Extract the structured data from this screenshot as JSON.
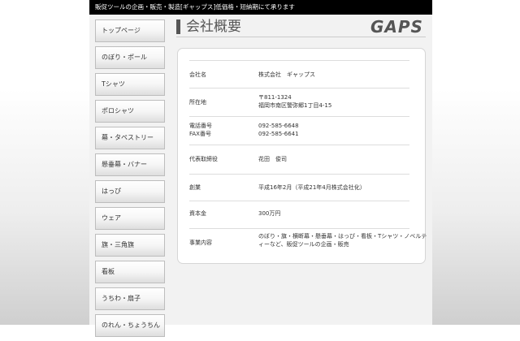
{
  "header": {
    "tagline": "販促ツールの企画・販売・製造[ギャップス]低価格・短納期にて承ります"
  },
  "sidebar": {
    "items": [
      {
        "label": "トップページ"
      },
      {
        "label": "のぼり・ポール"
      },
      {
        "label": "Tシャツ"
      },
      {
        "label": "ポロシャツ"
      },
      {
        "label": "幕・タペストリー"
      },
      {
        "label": "懸垂幕・バナー"
      },
      {
        "label": "はっぴ"
      },
      {
        "label": "ウェア"
      },
      {
        "label": "旗・三角旗"
      },
      {
        "label": "看板"
      },
      {
        "label": "うちわ・扇子"
      },
      {
        "label": "のれん・ちょうちん"
      }
    ]
  },
  "main": {
    "title": "会社概要",
    "logo": "GAPS",
    "rows": [
      {
        "label": "会社名",
        "lines": [
          "株式会社　ギャップス"
        ]
      },
      {
        "label": "所在地",
        "lines": [
          "〒811-1324",
          "福岡市南区警弥郷1丁目4-15"
        ]
      },
      {
        "label": "電話番号",
        "label2": "FAX番号",
        "lines": [
          "092-585-6648",
          "092-585-6641"
        ]
      },
      {
        "label": "代表取締役",
        "lines": [
          "花田　俊司"
        ]
      },
      {
        "label": "創業",
        "lines": [
          "平成16年2月（平成21年4月株式会社化）"
        ]
      },
      {
        "label": "資本金",
        "lines": [
          "300万円"
        ]
      },
      {
        "label": "事業内容",
        "lines": [
          "のぼり・旗・横断幕・懸垂幕・はっぴ・看板・Tシャツ・ノベルテ",
          "ィーなど、販促ツールの企画・販売"
        ]
      }
    ]
  },
  "colors": {
    "topbar": "#000000",
    "title_text": "#555555",
    "card_background": "#ffffff",
    "page_background": "#f2f2f2"
  }
}
